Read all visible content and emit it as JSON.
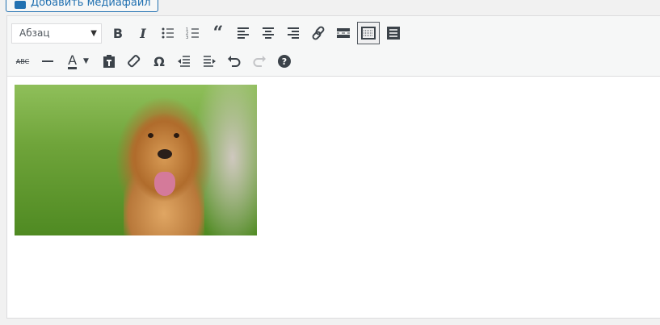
{
  "media_button": {
    "label": "Добавить медиафайл"
  },
  "toolbar": {
    "format_select": "Абзац",
    "row1": [
      "bold",
      "italic",
      "bulleted-list",
      "numbered-list",
      "blockquote",
      "align-left",
      "align-center",
      "align-right",
      "link",
      "read-more",
      "toolbar-toggle",
      "fullscreen"
    ],
    "row2": [
      "strikethrough",
      "horizontal-line",
      "text-color",
      "paste-text",
      "clear-formatting",
      "special-character",
      "outdent",
      "indent",
      "undo",
      "redo",
      "help"
    ],
    "glyphs": {
      "bold": "B",
      "italic": "I",
      "strike": "ABC",
      "text_color": "A",
      "omega": "Ω",
      "help": "?"
    }
  },
  "colors": {
    "accent": "#2271b1"
  }
}
